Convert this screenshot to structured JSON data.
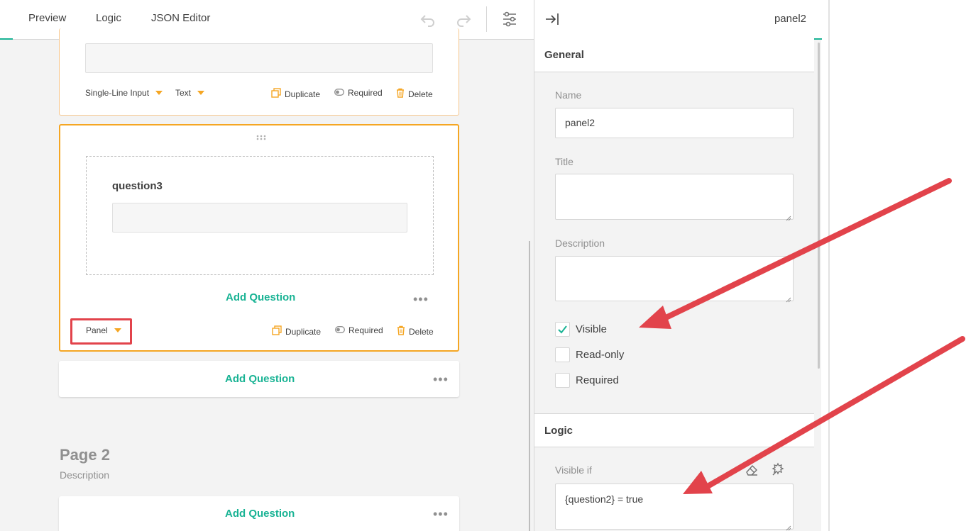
{
  "toolbar": {
    "tabs": [
      "Preview",
      "Logic",
      "JSON Editor"
    ],
    "undo_icon": "undo-icon",
    "redo_icon": "redo-icon",
    "settings_icon": "settings-sliders-icon"
  },
  "question_card": {
    "type_label": "Single-Line Input",
    "input_type_label": "Text",
    "duplicate_label": "Duplicate",
    "required_label": "Required",
    "delete_label": "Delete"
  },
  "panel_card": {
    "question_title": "question3",
    "add_question_label": "Add Question",
    "type_label": "Panel",
    "duplicate_label": "Duplicate",
    "required_label": "Required",
    "delete_label": "Delete"
  },
  "page1_add": {
    "add_question_label": "Add Question"
  },
  "page2": {
    "title": "Page 2",
    "description": "Description",
    "add_question_label": "Add Question"
  },
  "property_grid": {
    "selected_name": "panel2",
    "collapse_icon": "collapse-right-icon",
    "general": {
      "header": "General",
      "name_label": "Name",
      "name_value": "panel2",
      "title_label": "Title",
      "title_value": "",
      "description_label": "Description",
      "description_value": "",
      "visible_label": "Visible",
      "visible_checked": true,
      "readonly_label": "Read-only",
      "readonly_checked": false,
      "required_label": "Required",
      "required_checked": false
    },
    "logic": {
      "header": "Logic",
      "visible_if_label": "Visible if",
      "visible_if_value": "{question2} = true"
    }
  },
  "colors": {
    "accent": "#19b394",
    "selection": "#f5a623",
    "annotation": "#e2434b"
  }
}
